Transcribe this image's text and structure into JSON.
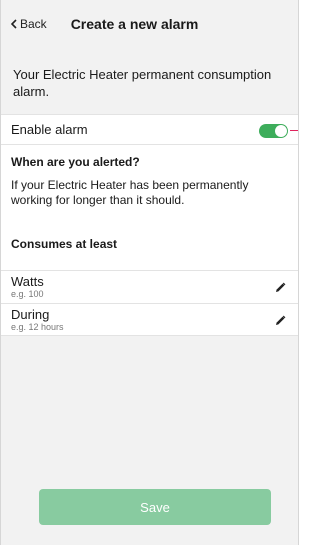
{
  "header": {
    "back_label": "Back",
    "title": "Create a new alarm"
  },
  "intro_text": "Your Electric Heater permanent consumption alarm.",
  "enable_alarm": {
    "label": "Enable alarm",
    "enabled": true,
    "toggle_color": "#3dad5b"
  },
  "alert_section": {
    "heading": "When are you alerted?",
    "description": "If your Electric Heater has been permanently working for longer than it should."
  },
  "consumes_section": {
    "heading": "Consumes at least",
    "fields": [
      {
        "label": "Watts",
        "placeholder": "e.g. 100",
        "icon": "pencil-icon"
      },
      {
        "label": "During",
        "placeholder": "e.g. 12 hours",
        "icon": "pencil-icon"
      }
    ]
  },
  "save_button": {
    "label": "Save",
    "color": "#88cba0"
  }
}
